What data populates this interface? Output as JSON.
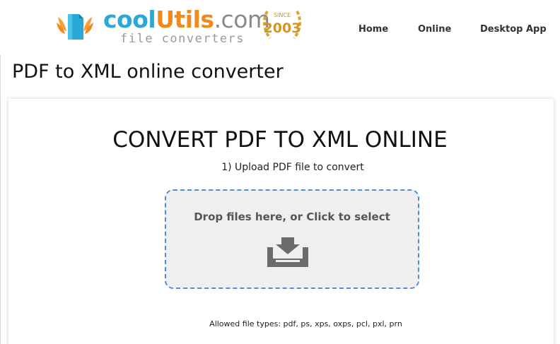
{
  "brand": {
    "name_part1": "cool",
    "name_part2": "Utils",
    "name_part3": ".com",
    "tagline": "file converters",
    "badge_top": "SINCE",
    "badge_year": "2003",
    "colors": {
      "cool": "#2aa9d6",
      "utils": "#f08a1c",
      "dom": "#8a8a8a"
    }
  },
  "nav": {
    "items": [
      {
        "label": "Home"
      },
      {
        "label": "Online"
      },
      {
        "label": "Desktop App"
      }
    ]
  },
  "page": {
    "title": "PDF to XML online converter"
  },
  "converter": {
    "heading": "CONVERT PDF TO XML ONLINE",
    "step_label": "1) Upload PDF file to convert",
    "dropzone_label": "Drop files here, or Click to select",
    "dropzone_icon": "download-tray-icon",
    "allowed_types": "Allowed file types: pdf, ps, xps, oxps, pcl, pxl, prn",
    "accent_color": "#4a90d9"
  }
}
